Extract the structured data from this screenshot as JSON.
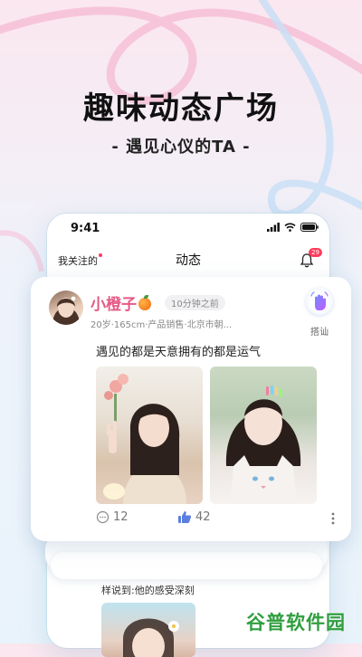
{
  "promo": {
    "headline": "趣味动态广场",
    "subline": "- 遇见心仪的TA -"
  },
  "status_bar": {
    "time": "9:41"
  },
  "app_nav": {
    "following_label": "我关注的",
    "title": "动态",
    "notification_count": "29"
  },
  "post": {
    "username": "小橙子",
    "username_emoji": "orange-emoji",
    "time_ago": "10分钟之前",
    "meta": "20岁·165cm·产品销售·北京市朝...",
    "greet_label": "搭讪",
    "text": "遇见的都是天意拥有的都是运气",
    "comment_count": "12",
    "like_count": "42"
  },
  "next_post": {
    "text": "样说到:他的感受深刻"
  },
  "watermark": "谷普软件园",
  "colors": {
    "accent_pink": "#e55a86",
    "badge_red": "#ff3b5c",
    "like_blue": "#5b7fe0",
    "watermark_green": "#2f9e3f"
  }
}
